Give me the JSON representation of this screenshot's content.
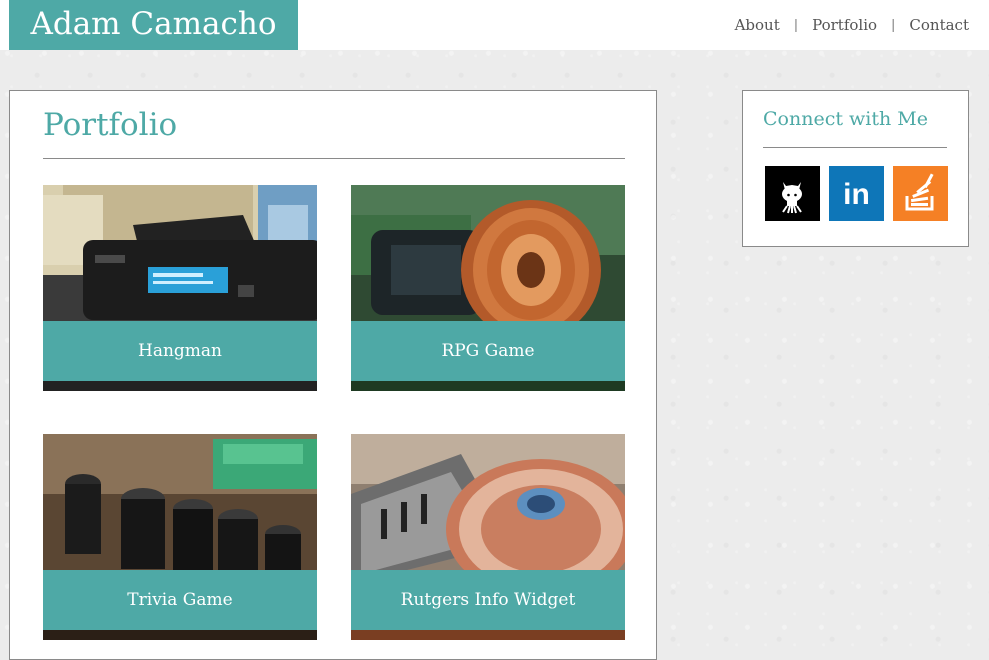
{
  "header": {
    "brand": "Adam Camacho",
    "nav": [
      {
        "label": "About"
      },
      {
        "label": "Portfolio"
      },
      {
        "label": "Contact"
      }
    ],
    "separator": "|"
  },
  "portfolio": {
    "title": "Portfolio",
    "items": [
      {
        "label": "Hangman"
      },
      {
        "label": "RPG Game"
      },
      {
        "label": "Trivia Game"
      },
      {
        "label": "Rutgers Info Widget"
      }
    ]
  },
  "sidebar": {
    "title": "Connect with Me",
    "links": [
      {
        "icon": "github-icon",
        "text": "in",
        "color": "#000000"
      },
      {
        "icon": "linkedin-icon",
        "text": "in",
        "color": "#0e76b8"
      },
      {
        "icon": "stackoverflow-icon",
        "color": "#f58025"
      }
    ]
  },
  "colors": {
    "accent": "#4ea9a6",
    "background": "#ececec"
  }
}
